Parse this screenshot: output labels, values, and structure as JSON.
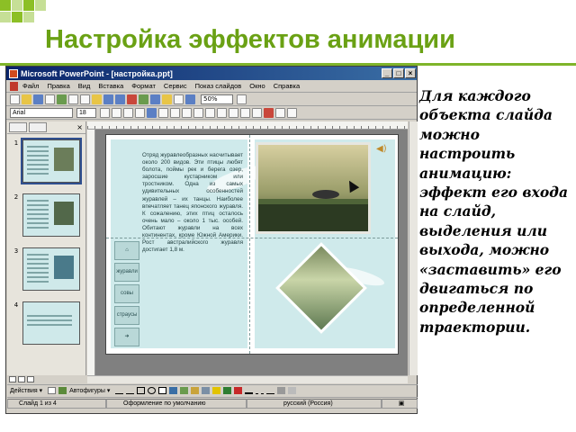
{
  "slide_title": "Настройка эффектов анимации",
  "description": "Для каждого объекта слайда можно настроить анимацию: эффект его входа на слайд, выделения или выхода, можно «заставить» его двигаться по определенной траектории.",
  "window": {
    "title": "Microsoft PowerPoint - [настройка.ppt]",
    "buttons": {
      "minimize": "_",
      "maximize": "□",
      "close": "×"
    }
  },
  "menu": [
    "Файл",
    "Правка",
    "Вид",
    "Вставка",
    "Формат",
    "Сервис",
    "Показ слайдов",
    "Окно",
    "Справка"
  ],
  "toolbar": {
    "zoom": "50%"
  },
  "format_bar": {
    "font": "Arial",
    "size": "18"
  },
  "left_panel": {
    "close": "×",
    "thumb_numbers": [
      "1",
      "2",
      "3",
      "4"
    ]
  },
  "slide": {
    "body_text": "Отряд журавлеобразных насчитывает около 200 видов. Эти птицы любят болота, поймы рек и берега озер, заросшие кустарником или тростником. Одна из самых удивительных особенностей журавлей – их танцы. Наиболее впечатляет танец японского журавля. К сожалению, этих птиц осталось очень мало – около 1 тыс. особей. Обитают журавли на всех континентах, кроме Южной Америки. Рост австралийского журавля достигает 1,8 м.",
    "nav_buttons": [
      "журавли",
      "совы",
      "страусы"
    ]
  },
  "draw_bar": {
    "actions": "Действия ▾",
    "autoshapes": "Автофигуры ▾"
  },
  "status_bar": {
    "slide": "Слайд 1 из 4",
    "design": "Оформление по умолчанию",
    "language": "русский (Россия)"
  },
  "colors": {
    "accent": "#6aa114",
    "titlebar": "#0a246a",
    "slide_bg": "#cfeaeb"
  }
}
